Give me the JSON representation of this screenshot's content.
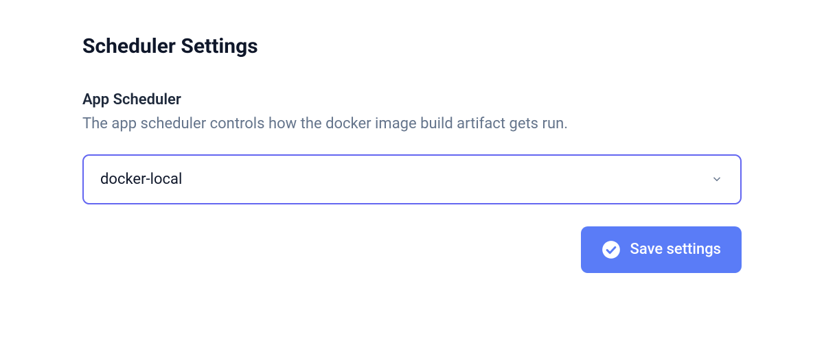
{
  "header": {
    "title": "Scheduler Settings"
  },
  "section": {
    "label": "App Scheduler",
    "description": "The app scheduler controls how the docker image build artifact gets run."
  },
  "select": {
    "value": "docker-local"
  },
  "actions": {
    "save_label": "Save settings"
  },
  "colors": {
    "accent": "#6366f1",
    "button": "#5a7cf7",
    "text_primary": "#0f172a",
    "text_secondary": "#64748b"
  }
}
